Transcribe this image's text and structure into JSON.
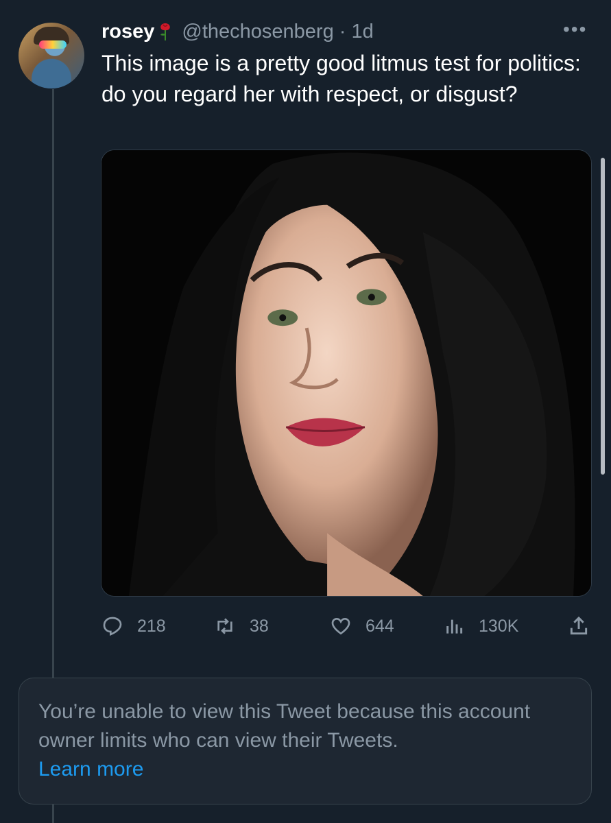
{
  "tweet": {
    "display_name": "rosey",
    "name_emoji_icon": "rose-icon",
    "handle": "@thechosenberg",
    "separator": "·",
    "time": "1d",
    "more_icon": "more-options-icon",
    "text": "This image is a pretty good litmus test for politics: do you regard her with respect, or disgust?",
    "media_icon": "portrait-photo"
  },
  "actions": {
    "replies": "218",
    "retweets": "38",
    "likes": "644",
    "views": "130K",
    "reply_icon": "reply-icon",
    "retweet_icon": "retweet-icon",
    "like_icon": "heart-icon",
    "views_icon": "analytics-icon",
    "share_icon": "share-icon"
  },
  "notice": {
    "text": "You’re unable to view this Tweet because this account owner limits who can view their Tweets.",
    "link": "Learn more"
  },
  "colors": {
    "background": "#16202b",
    "secondary_text": "#8b98a5",
    "link": "#1d9bf0",
    "border": "#38444d"
  }
}
